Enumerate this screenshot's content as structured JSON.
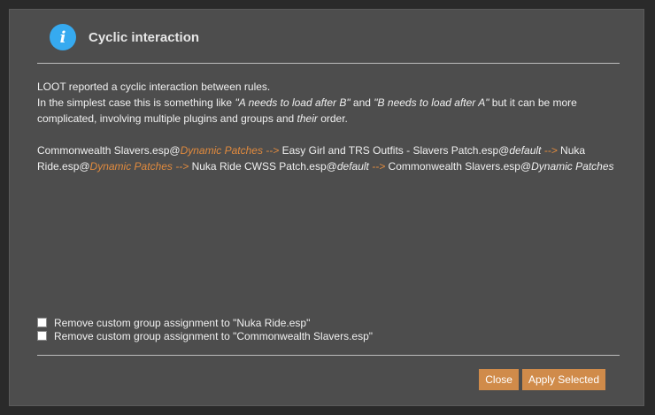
{
  "dialog": {
    "title": "Cyclic interaction",
    "icon": "info-icon",
    "accent_color": "#e08a3e",
    "icon_color": "#36aaf0"
  },
  "message": {
    "line1": "LOOT reported a cyclic interaction between rules.",
    "line2_prefix": "In the simplest case this is something like ",
    "line2_example1": "\"A needs to load after B\"",
    "line2_and": " and ",
    "line2_example2": "\"B needs to load after A\"",
    "line2_mid": " but it can be more complicated, involving multiple plugins and groups and ",
    "line2_their": "their",
    "line2_suffix": " order."
  },
  "cycle": [
    {
      "plugin": "Commonwealth Slavers.esp@",
      "group": "Dynamic Patches",
      "group_kind": "accent"
    },
    {
      "arrow": " --> "
    },
    {
      "plugin": "Easy Girl and TRS Outfits - Slavers Patch.esp@",
      "group": "default",
      "group_kind": "italic"
    },
    {
      "arrow": " --> "
    },
    {
      "plugin": "Nuka Ride.esp@",
      "group": "Dynamic Patches",
      "group_kind": "accent"
    },
    {
      "arrow": " --> "
    },
    {
      "plugin": "Nuka Ride CWSS Patch.esp@",
      "group": "default",
      "group_kind": "italic"
    },
    {
      "arrow": " --> "
    },
    {
      "plugin": "Commonwealth Slavers.esp@",
      "group": "Dynamic Patches",
      "group_kind": "italic"
    }
  ],
  "options": [
    {
      "label": "Remove custom group assignment to \"Nuka Ride.esp\"",
      "checked": false
    },
    {
      "label": "Remove custom group assignment to \"Commonwealth Slavers.esp\"",
      "checked": false
    }
  ],
  "buttons": {
    "close": "Close",
    "apply": "Apply Selected"
  }
}
